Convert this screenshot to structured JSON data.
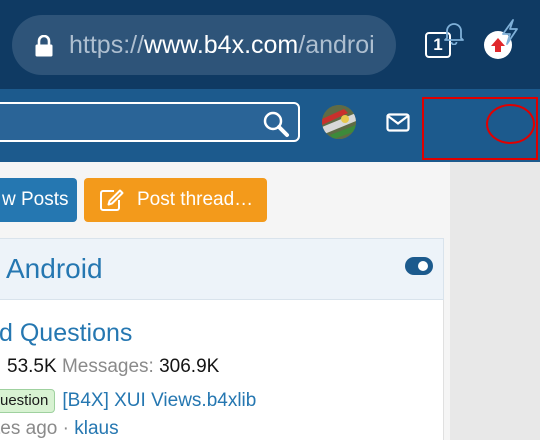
{
  "browser": {
    "url_scheme": "https://",
    "url_domain": "www.b4x.com",
    "url_path": "/androi",
    "tab_count": "1",
    "icons": {
      "lock": "lock-icon",
      "extension": "upload-arrow-icon"
    },
    "colors": {
      "toolbar": "#0f3a63",
      "extension_icon": "#e0282c"
    }
  },
  "header": {
    "search_placeholder": "",
    "icons": [
      "search-icon",
      "avatar",
      "mail-icon",
      "bell-icon",
      "bolt-icon"
    ],
    "colors": {
      "bar": "#1c5a8d",
      "annotation": "#e00000"
    }
  },
  "actions": {
    "new_posts": "w Posts",
    "post_thread": "Post thread…"
  },
  "node": {
    "title": " Android",
    "toggle_icon": "toggle-icon"
  },
  "forum": {
    "title": "d Questions",
    "threads_value": "53.5K",
    "messages_label": "Messages:",
    "messages_value": "306.9K",
    "latest": {
      "prefix": "uestion",
      "thread_title": "[B4X] XUI Views.b4xlib",
      "time": "tes ago",
      "separator": "·",
      "user": "klaus"
    }
  }
}
